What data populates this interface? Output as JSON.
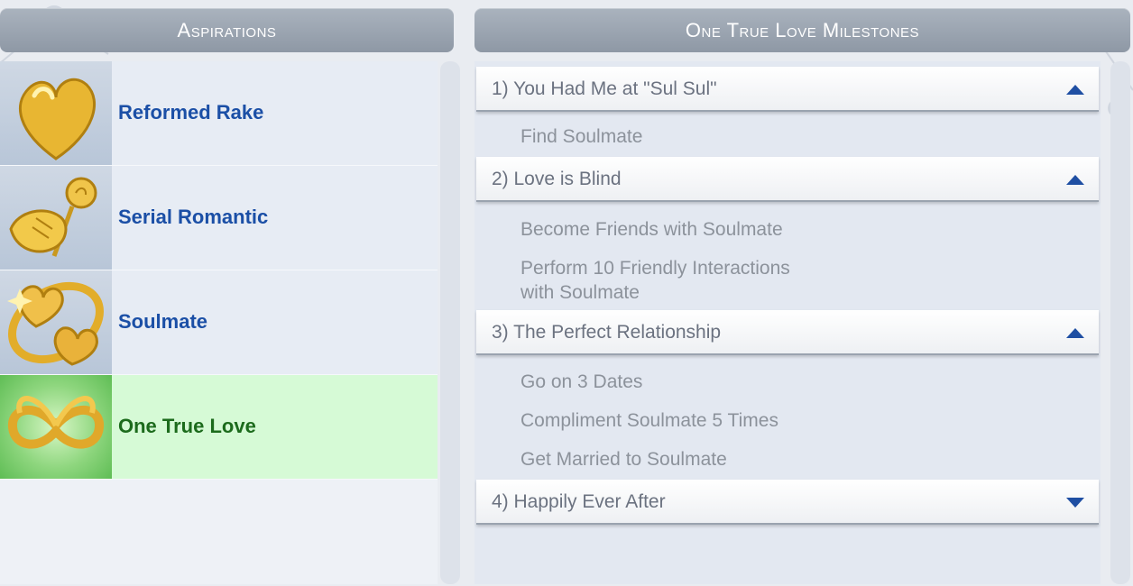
{
  "aspirations": {
    "header": "Aspirations",
    "items": [
      {
        "label": "Reformed Rake",
        "icon": "golden-heart-icon",
        "selected": false
      },
      {
        "label": "Serial Romantic",
        "icon": "hand-holding-rose-icon",
        "selected": false
      },
      {
        "label": "Soulmate",
        "icon": "entwined-hearts-icon",
        "selected": false
      },
      {
        "label": "One True Love",
        "icon": "infinity-heart-icon",
        "selected": true
      }
    ]
  },
  "milestones": {
    "header": "One True Love Milestones",
    "groups": [
      {
        "title": "1) You Had Me at \"Sul Sul\"",
        "expanded": true,
        "goals": [
          "Find Soulmate"
        ]
      },
      {
        "title": "2) Love is Blind",
        "expanded": true,
        "goals": [
          "Become Friends with Soulmate",
          "Perform 10 Friendly Interactions",
          "with Soulmate"
        ]
      },
      {
        "title": "3) The Perfect Relationship",
        "expanded": true,
        "goals": [
          "Go on 3 Dates",
          "Compliment Soulmate 5 Times",
          "Get Married to Soulmate"
        ]
      },
      {
        "title": "4) Happily Ever After",
        "expanded": false,
        "goals": []
      }
    ]
  },
  "colors": {
    "header_bg": "#9aa4b1",
    "aspiration_label": "#1b4fa6",
    "selected_label": "#1c6b1c",
    "selected_bg": "#d6fad6",
    "chevron": "#1f4fa3",
    "goal_text": "#8c929b"
  }
}
